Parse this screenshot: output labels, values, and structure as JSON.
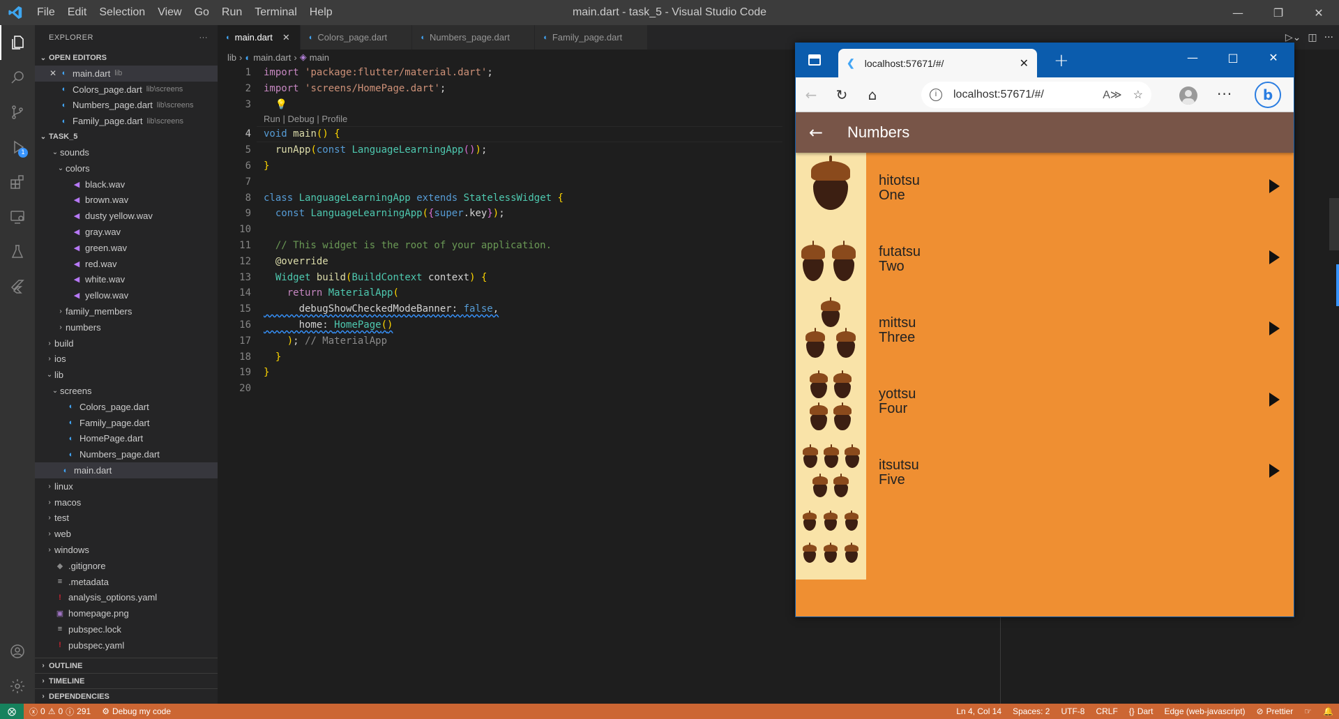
{
  "window": {
    "title": "main.dart - task_5 - Visual Studio Code",
    "menu": [
      "File",
      "Edit",
      "Selection",
      "View",
      "Go",
      "Run",
      "Terminal",
      "Help"
    ]
  },
  "activity_bar": {
    "items": [
      "explorer-icon",
      "search-icon",
      "source-control-icon",
      "run-debug-icon",
      "extensions-icon",
      "remote-explorer-icon",
      "testing-icon",
      "flutter-icon"
    ],
    "debug_badge": "1",
    "bottom": [
      "accounts-icon",
      "manage-gear-icon"
    ]
  },
  "sidebar": {
    "title": "EXPLORER",
    "more": "···",
    "open_editors": {
      "label": "OPEN EDITORS",
      "items": [
        {
          "name": "main.dart",
          "desc": "lib"
        },
        {
          "name": "Colors_page.dart",
          "desc": "lib\\screens"
        },
        {
          "name": "Numbers_page.dart",
          "desc": "lib\\screens"
        },
        {
          "name": "Family_page.dart",
          "desc": "lib\\screens"
        }
      ]
    },
    "project": {
      "label": "TASK_5",
      "tree": [
        {
          "name": "sounds",
          "type": "folder-open",
          "depth": 1
        },
        {
          "name": "colors",
          "type": "folder-open",
          "depth": 2
        },
        {
          "name": "black.wav",
          "type": "wav",
          "depth": 3
        },
        {
          "name": "brown.wav",
          "type": "wav",
          "depth": 3
        },
        {
          "name": "dusty yellow.wav",
          "type": "wav",
          "depth": 3
        },
        {
          "name": "gray.wav",
          "type": "wav",
          "depth": 3
        },
        {
          "name": "green.wav",
          "type": "wav",
          "depth": 3
        },
        {
          "name": "red.wav",
          "type": "wav",
          "depth": 3
        },
        {
          "name": "white.wav",
          "type": "wav",
          "depth": 3
        },
        {
          "name": "yellow.wav",
          "type": "wav",
          "depth": 3
        },
        {
          "name": "family_members",
          "type": "folder",
          "depth": 2
        },
        {
          "name": "numbers",
          "type": "folder",
          "depth": 2
        },
        {
          "name": "build",
          "type": "folder",
          "depth": 0
        },
        {
          "name": "ios",
          "type": "folder",
          "depth": 0
        },
        {
          "name": "lib",
          "type": "folder-open",
          "depth": 0
        },
        {
          "name": "screens",
          "type": "folder-open",
          "depth": 1
        },
        {
          "name": "Colors_page.dart",
          "type": "dart",
          "depth": 2
        },
        {
          "name": "Family_page.dart",
          "type": "dart",
          "depth": 2
        },
        {
          "name": "HomePage.dart",
          "type": "dart",
          "depth": 2
        },
        {
          "name": "Numbers_page.dart",
          "type": "dart",
          "depth": 2
        },
        {
          "name": "main.dart",
          "type": "dart",
          "depth": 1,
          "selected": true
        },
        {
          "name": "linux",
          "type": "folder",
          "depth": 0
        },
        {
          "name": "macos",
          "type": "folder",
          "depth": 0
        },
        {
          "name": "test",
          "type": "folder",
          "depth": 0
        },
        {
          "name": "web",
          "type": "folder",
          "depth": 0
        },
        {
          "name": "windows",
          "type": "folder",
          "depth": 0
        },
        {
          "name": ".gitignore",
          "type": "git",
          "depth": 0
        },
        {
          "name": ".metadata",
          "type": "lines",
          "depth": 0
        },
        {
          "name": "analysis_options.yaml",
          "type": "yaml",
          "depth": 0
        },
        {
          "name": "homepage.png",
          "type": "png",
          "depth": 0
        },
        {
          "name": "pubspec.lock",
          "type": "lines",
          "depth": 0
        },
        {
          "name": "pubspec.yaml",
          "type": "yaml",
          "depth": 0
        }
      ]
    },
    "bottom_sections": [
      "OUTLINE",
      "TIMELINE",
      "DEPENDENCIES"
    ]
  },
  "editor": {
    "tabs": [
      {
        "label": "main.dart",
        "active": true
      },
      {
        "label": "Colors_page.dart",
        "active": false
      },
      {
        "label": "Numbers_page.dart",
        "active": false
      },
      {
        "label": "Family_page.dart",
        "active": false
      }
    ],
    "breadcrumb": [
      "lib",
      "main.dart",
      "main"
    ],
    "codelens": "Run | Debug | Profile",
    "current_line": 4,
    "lines": [
      "import 'package:flutter/material.dart';",
      "import 'screens/HomePage.dart';",
      "",
      "void main() {",
      "  runApp(const LanguageLearningApp());",
      "}",
      "",
      "class LanguageLearningApp extends StatelessWidget {",
      "  const LanguageLearningApp({super.key});",
      "",
      "  // This widget is the root of your application.",
      "  @override",
      "  Widget build(BuildContext context) {",
      "    return MaterialApp(",
      "      debugShowCheckedModeBanner: false,",
      "      home: HomePage()",
      "    ); // MaterialApp",
      "  }",
      "}",
      ""
    ]
  },
  "browser": {
    "tab_title": "localhost:57671/#/",
    "url": "localhost:57671/#/",
    "app": {
      "title": "Numbers",
      "items": [
        {
          "japanese": "hitotsu",
          "english": "One",
          "count": 1
        },
        {
          "japanese": "futatsu",
          "english": "Two",
          "count": 2
        },
        {
          "japanese": "mittsu",
          "english": "Three",
          "count": 3
        },
        {
          "japanese": "yottsu",
          "english": "Four",
          "count": 4
        },
        {
          "japanese": "itsutsu",
          "english": "Five",
          "count": 5
        },
        {
          "japanese": "",
          "english": "",
          "count": 6
        }
      ]
    }
  },
  "statusbar": {
    "errors": "0",
    "warnings": "0",
    "infos": "291",
    "debug": "Debug my code",
    "position": "Ln 4, Col 14",
    "spaces": "Spaces: 2",
    "encoding": "UTF-8",
    "eol": "CRLF",
    "language": "Dart",
    "device": "Edge (web-javascript)",
    "prettier": "Prettier"
  }
}
